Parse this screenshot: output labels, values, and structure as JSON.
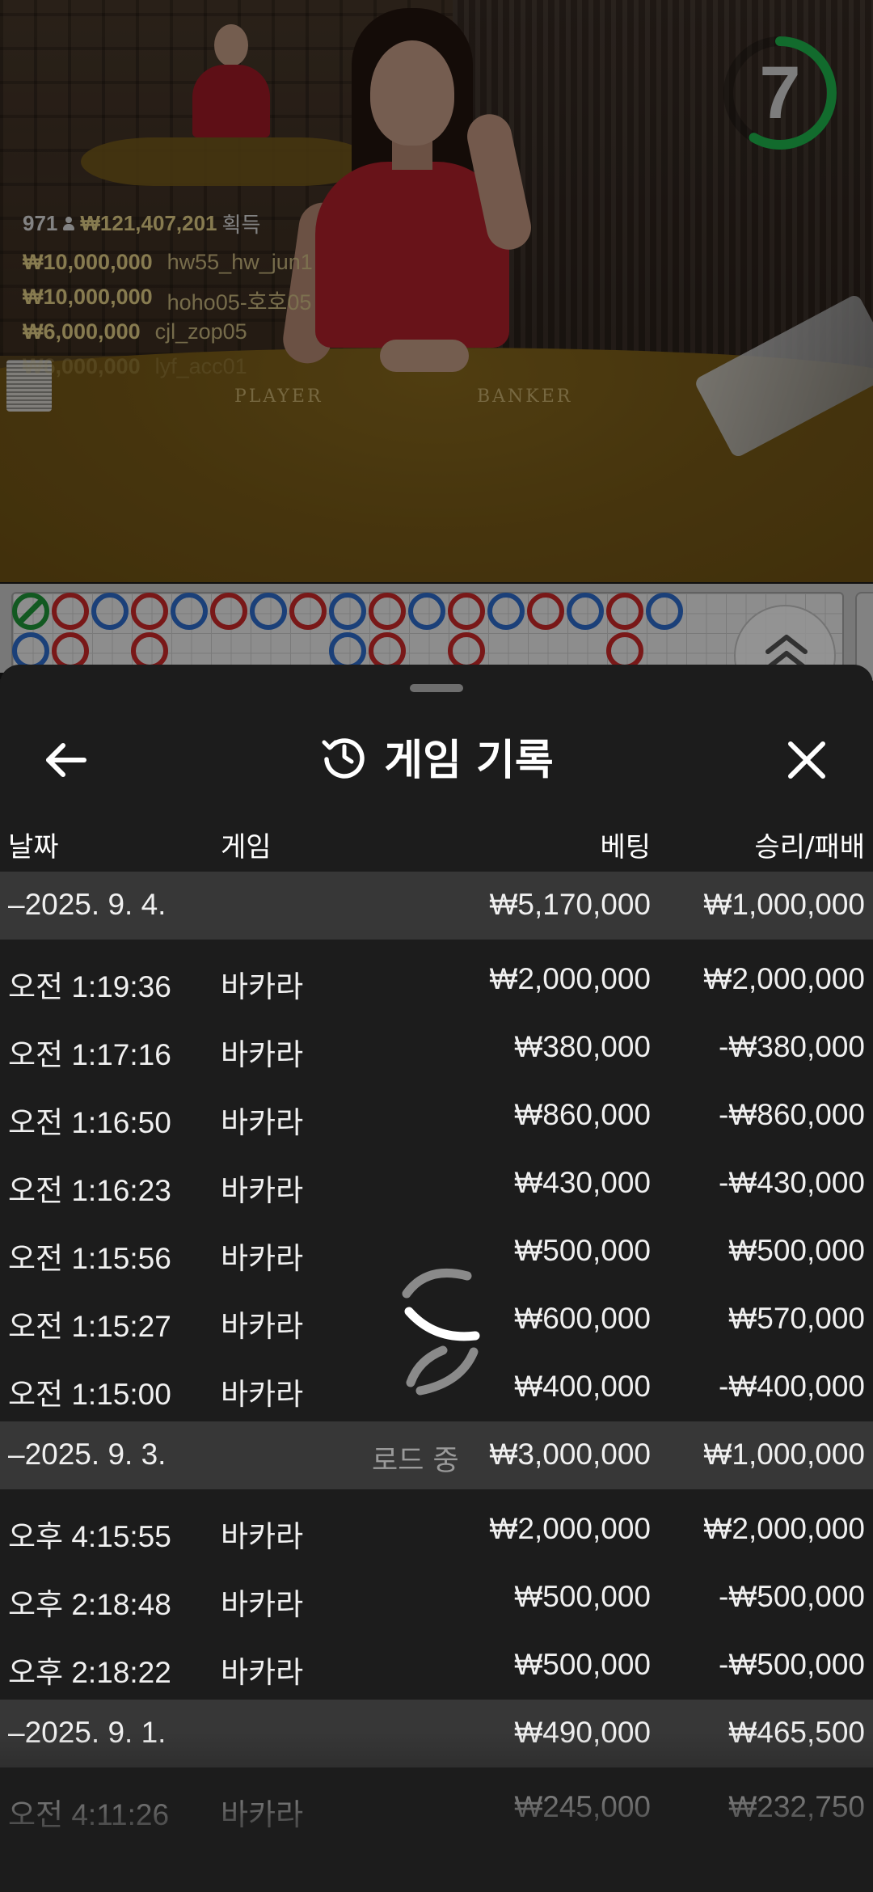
{
  "video": {
    "countdown": "7",
    "table_labels": {
      "player": "PLAYER",
      "banker": "BANKER"
    },
    "winners_summary": {
      "count": "971",
      "total": "₩121,407,201",
      "suffix": "획득"
    },
    "winners": [
      {
        "amount": "₩10,000,000",
        "name": "hw55_hw_jun1"
      },
      {
        "amount": "₩10,000,000",
        "name": "hoho05-호호05"
      },
      {
        "amount": "₩6,000,000",
        "name": "cjl_zop05"
      },
      {
        "amount": "₩6,000,000",
        "name": "lyf_acc01"
      }
    ]
  },
  "bead_road": {
    "colors": {
      "player": "#2f6fd0",
      "banker": "#d02a2a",
      "tie": "#1f9a3a"
    },
    "top_row": [
      "tie",
      "banker",
      "player",
      "banker",
      "player",
      "banker",
      "player",
      "banker",
      "player",
      "banker",
      "player",
      "banker",
      "player",
      "banker",
      "player",
      "banker",
      "player"
    ],
    "bottom_row": [
      {
        "col": 0,
        "result": "player"
      },
      {
        "col": 1,
        "result": "banker"
      },
      {
        "col": 3,
        "result": "banker"
      },
      {
        "col": 8,
        "result": "player"
      },
      {
        "col": 9,
        "result": "banker"
      },
      {
        "col": 11,
        "result": "banker"
      },
      {
        "col": 15,
        "result": "banker"
      }
    ]
  },
  "sheet": {
    "title": "게임 기록",
    "columns": {
      "date": "날짜",
      "game": "게임",
      "bet": "베팅",
      "result": "승리/패배"
    },
    "loading_text": "로드 중",
    "groups": [
      {
        "date": "–2025. 9. 4.",
        "bet": "₩5,170,000",
        "result": "₩1,000,000",
        "rows": [
          {
            "time": "오전 1:19:36",
            "game": "바카라",
            "bet": "₩2,000,000",
            "result": "₩2,000,000"
          },
          {
            "time": "오전 1:17:16",
            "game": "바카라",
            "bet": "₩380,000",
            "result": "-₩380,000"
          },
          {
            "time": "오전 1:16:50",
            "game": "바카라",
            "bet": "₩860,000",
            "result": "-₩860,000"
          },
          {
            "time": "오전 1:16:23",
            "game": "바카라",
            "bet": "₩430,000",
            "result": "-₩430,000"
          },
          {
            "time": "오전 1:15:56",
            "game": "바카라",
            "bet": "₩500,000",
            "result": "₩500,000"
          },
          {
            "time": "오전 1:15:27",
            "game": "바카라",
            "bet": "₩600,000",
            "result": "₩570,000"
          },
          {
            "time": "오전 1:15:00",
            "game": "바카라",
            "bet": "₩400,000",
            "result": "-₩400,000"
          }
        ]
      },
      {
        "date": "–2025. 9. 3.",
        "bet": "₩3,000,000",
        "result": "₩1,000,000",
        "rows": [
          {
            "time": "오후 4:15:55",
            "game": "바카라",
            "bet": "₩2,000,000",
            "result": "₩2,000,000"
          },
          {
            "time": "오후 2:18:48",
            "game": "바카라",
            "bet": "₩500,000",
            "result": "-₩500,000"
          },
          {
            "time": "오후 2:18:22",
            "game": "바카라",
            "bet": "₩500,000",
            "result": "-₩500,000"
          }
        ]
      },
      {
        "date": "–2025. 9. 1.",
        "bet": "₩490,000",
        "result": "₩465,500",
        "rows": [
          {
            "time": "오전 4:11:26",
            "game": "바카라",
            "bet": "₩245,000",
            "result": "₩232,750"
          }
        ]
      }
    ]
  },
  "icons": {
    "back": "arrow-left-icon",
    "close": "close-icon",
    "history": "history-icon",
    "expand": "chevron-up-double-icon",
    "spinner": "loading-spinner-icon"
  }
}
